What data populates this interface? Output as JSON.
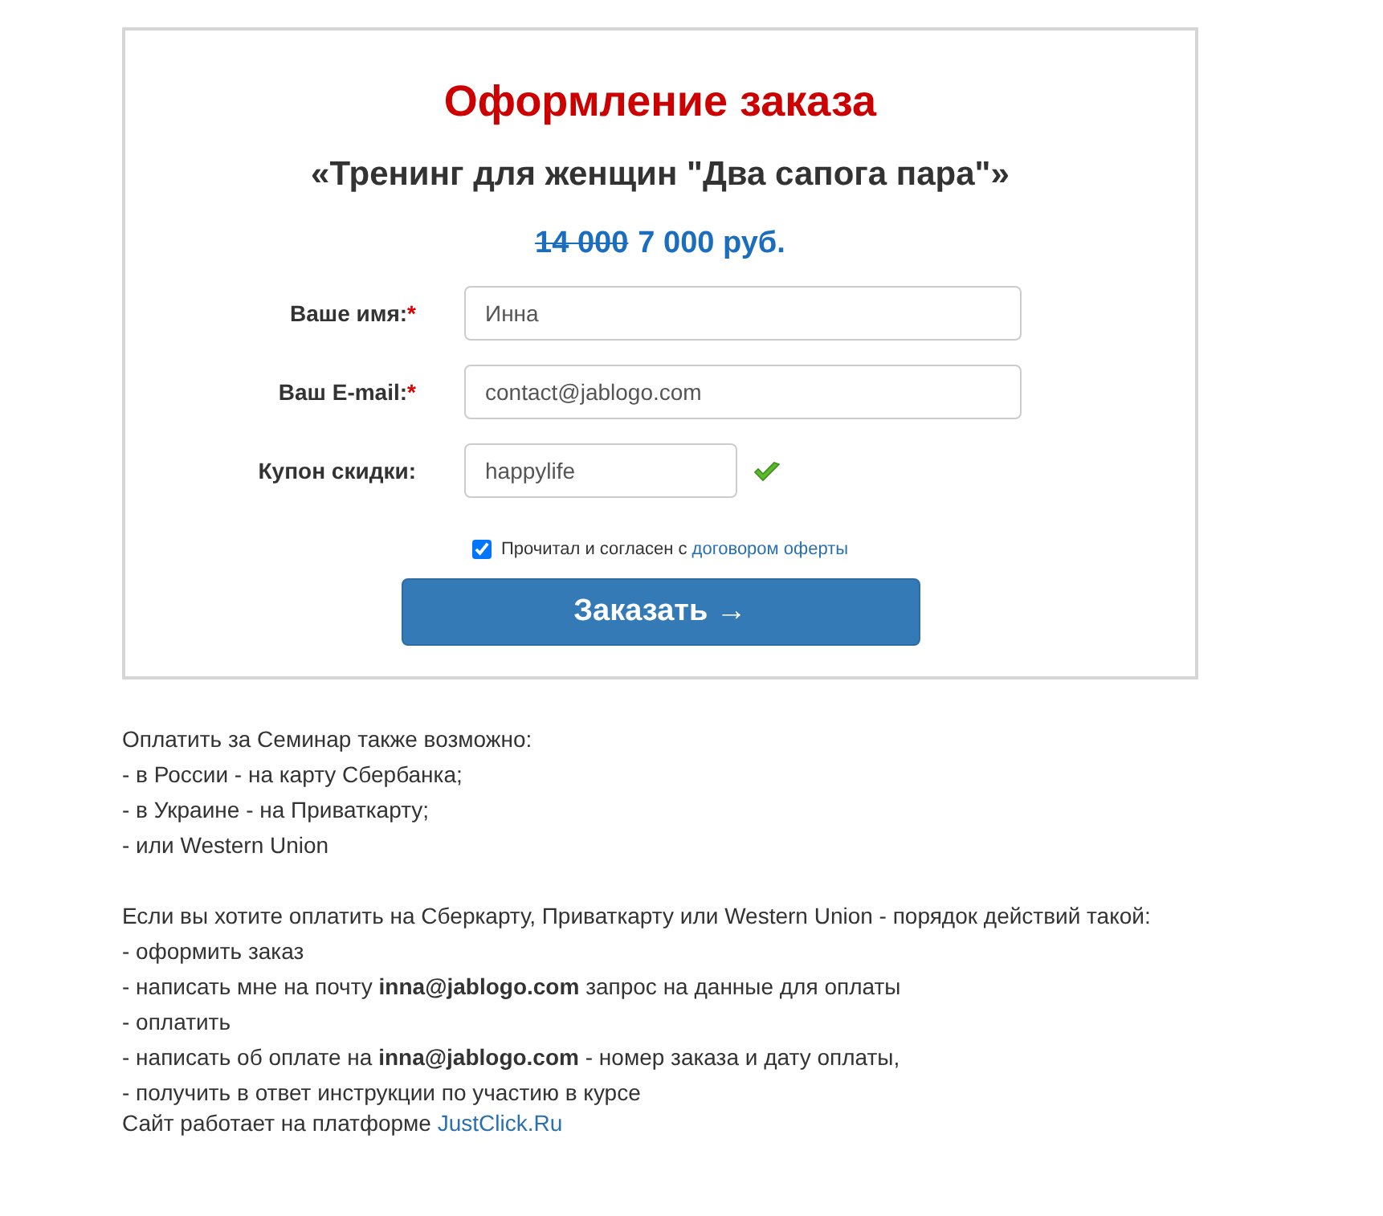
{
  "order_form": {
    "title": "Оформление заказа",
    "product": "«Тренинг для женщин \"Два сапога пара\"»",
    "old_price": "14 000",
    "price": "7 000 руб.",
    "fields": [
      {
        "kind": "text",
        "label": "Ваше имя:",
        "required_mark": "*",
        "value": "Инна"
      },
      {
        "kind": "text",
        "label": "Ваш E-mail:",
        "required_mark": "*",
        "value": "contact@jablogo.com"
      },
      {
        "kind": "coupon",
        "label": "Купон скидки:",
        "value": "happylife",
        "valid": true
      }
    ],
    "agreement": {
      "checked": true,
      "text": "Прочитал и согласен с",
      "link": "договором оферты"
    },
    "submit": "Заказать →"
  },
  "info": [
    [
      "Оплатить за Семинар также возможно:",
      "- в России - на карту Сбербанка;",
      "- в Украине - на Приваткарту;",
      "- или Western Union"
    ],
    [
      "Если вы хотите оплатить на Сберкарту, Приваткарту или Western Union - порядок действий такой:",
      "- оформить заказ",
      "- написать мне на почту **inna@jablogo.com** запрос на данные для оплаты",
      "- оплатить",
      "- написать об оплате на **inna@jablogo.com** - номер заказа и дату оплаты,",
      "- получить в ответ инструкции по участию в курсе"
    ]
  ],
  "footer": {
    "text": "Сайт работает на платформе",
    "link": "JustClick.Ru"
  }
}
